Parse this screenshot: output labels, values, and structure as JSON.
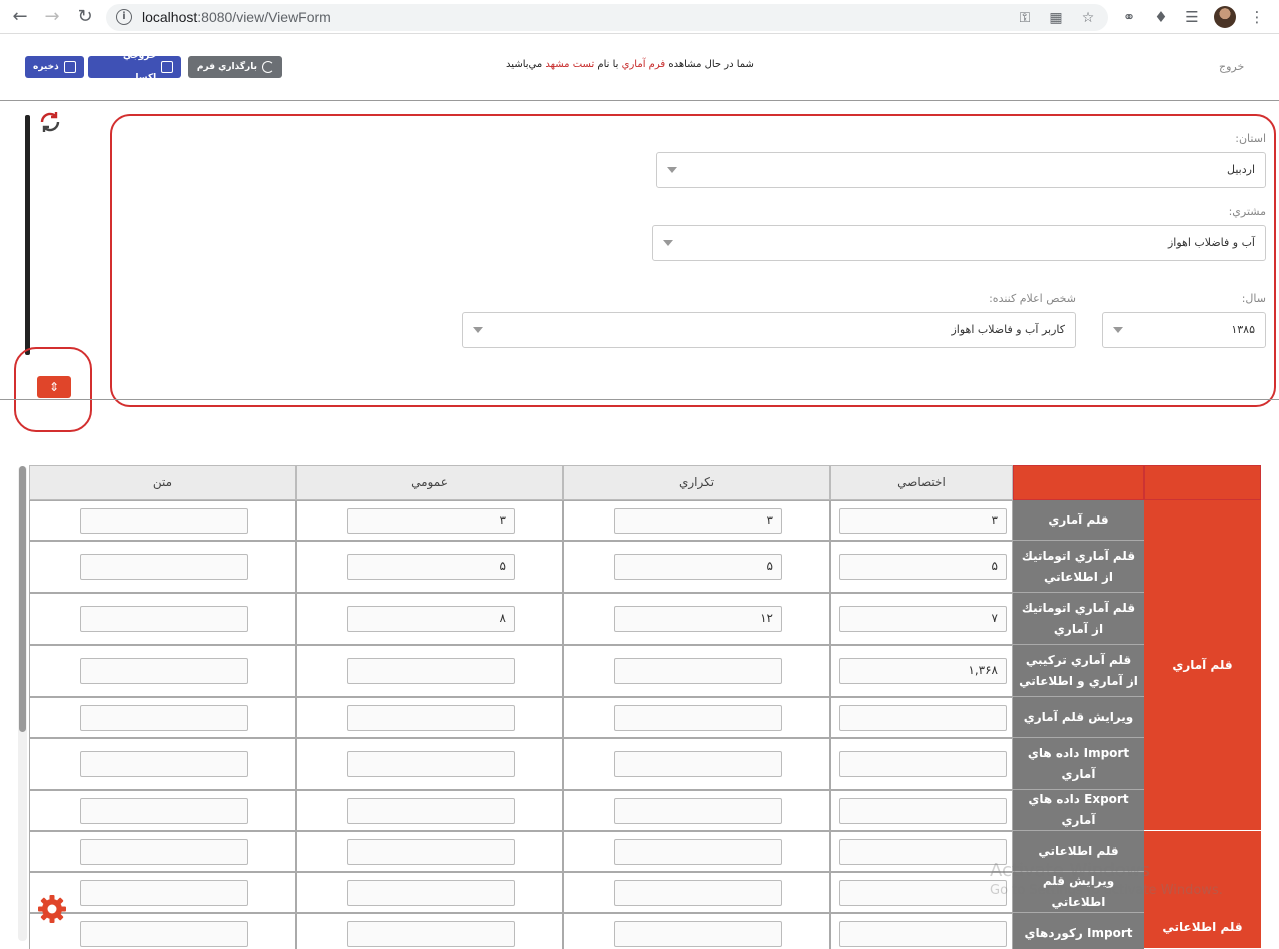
{
  "browser": {
    "url_host": "localhost",
    "url_rest": ":8080/view/ViewForm"
  },
  "header": {
    "save_label": "ذخيره",
    "excel_label": "خروجي اكسل",
    "reload_label": "بارگذاري فرم",
    "msg_part1": "شما در حال مشاهده ",
    "msg_form": "فرم آماري",
    "msg_part2": " با نام ",
    "msg_name": "تست مشهد",
    "msg_part3": " مي‌باشيد",
    "exit_label": "خروج"
  },
  "filters": {
    "province_label": "استان:",
    "province_value": "اردبيل",
    "customer_label": "مشتري:",
    "customer_value": "آب و فاضلاب اهواز",
    "year_label": "سال:",
    "year_value": "۱۳۸۵",
    "declarer_label": "شخص اعلام كننده:",
    "declarer_value": "كاربر آب و فاضلاب اهواز"
  },
  "table": {
    "columns": [
      "اختصاصي",
      "تكراري",
      "عمومي",
      "متن"
    ],
    "group1": "قلم آماري",
    "group2": "قلم اطلاعاتي",
    "rows": [
      {
        "label": "قلم آماري",
        "v": [
          "۳",
          "۳",
          "۳",
          ""
        ]
      },
      {
        "label": "قلم آماري اتوماتيك از اطلاعاتي",
        "v": [
          "۵",
          "۵",
          "۵",
          ""
        ]
      },
      {
        "label": "قلم آماري اتوماتيك از آماري",
        "v": [
          "۷",
          "۱۲",
          "۸",
          ""
        ]
      },
      {
        "label": "قلم آماري تركيبي از آماري و اطلاعاتي",
        "v": [
          "۱,۳۶۸",
          "",
          "",
          ""
        ]
      },
      {
        "label": "ويرايش قلم آماري",
        "v": [
          "",
          "",
          "",
          ""
        ]
      },
      {
        "label": "Import داده هاي آماري",
        "v": [
          "",
          "",
          "",
          ""
        ]
      },
      {
        "label": "Export داده هاي آماري",
        "v": [
          "",
          "",
          "",
          ""
        ]
      },
      {
        "label": "قلم اطلاعاتي",
        "v": [
          "",
          "",
          "",
          ""
        ]
      },
      {
        "label": "ويرايش قلم اطلاعاتي",
        "v": [
          "",
          "",
          "",
          ""
        ]
      },
      {
        "label": "Import ركوردهاي",
        "v": [
          "",
          "",
          "",
          ""
        ]
      }
    ]
  },
  "watermark": {
    "line1": "Activate Windows",
    "line2": "Go to Settings to activate Windows."
  }
}
